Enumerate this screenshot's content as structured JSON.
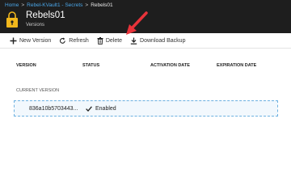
{
  "breadcrumb": {
    "items": [
      "Home",
      "Rebel-KVault1 - Secrets",
      "Rebels01"
    ]
  },
  "header": {
    "title": "Rebels01",
    "subtitle": "Versions",
    "icon": "key-icon"
  },
  "toolbar": {
    "new_version": "New Version",
    "refresh": "Refresh",
    "delete": "Delete",
    "download_backup": "Download Backup"
  },
  "table": {
    "columns": [
      "VERSION",
      "STATUS",
      "ACTIVATION DATE",
      "EXPIRATION DATE"
    ],
    "section_label": "CURRENT VERSION",
    "rows": [
      {
        "version": "836a10b5703443...",
        "status": "Enabled",
        "activation": "",
        "expiration": ""
      }
    ]
  },
  "colors": {
    "topbar": "#1e1e1e",
    "link": "#4aa6e8",
    "key_gold": "#f2b81c",
    "annotation_arrow": "#e8333a",
    "row_border": "#6cb0e0"
  }
}
